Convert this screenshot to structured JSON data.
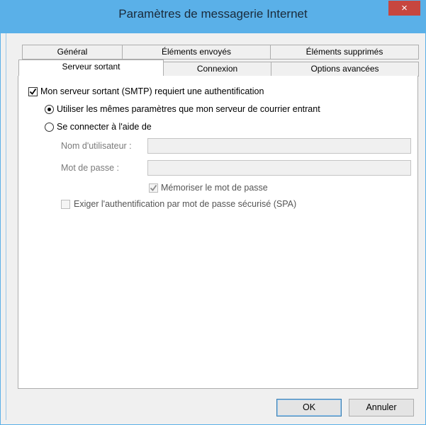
{
  "window": {
    "title": "Paramètres de messagerie Internet",
    "close_label": "×"
  },
  "tabs": {
    "row1": [
      "Général",
      "Éléments envoyés",
      "Éléments supprimés"
    ],
    "row2": [
      "Serveur sortant",
      "Connexion",
      "Options avancées"
    ],
    "active": "Serveur sortant"
  },
  "outgoing": {
    "smtp_auth_label": "Mon serveur sortant (SMTP) requiert une authentification",
    "smtp_auth_checked": true,
    "same_settings_label": "Utiliser les mêmes paramètres que mon serveur de courrier entrant",
    "same_settings_selected": true,
    "login_with_label": "Se connecter à l'aide de",
    "login_with_selected": false,
    "username_label": "Nom d'utilisateur :",
    "username_value": "",
    "password_label": "Mot de passe :",
    "password_value": "",
    "remember_password_label": "Mémoriser le mot de passe",
    "remember_password_checked": true,
    "spa_label": "Exiger l'authentification par mot de passe sécurisé (SPA)",
    "spa_checked": false
  },
  "buttons": {
    "ok_label": "OK",
    "cancel_label": "Annuler"
  }
}
